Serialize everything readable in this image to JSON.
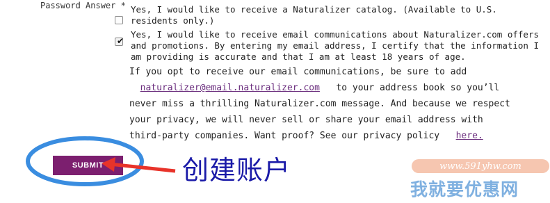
{
  "form": {
    "field_label": "Password Answer *",
    "optin_catalog": {
      "text": "Yes, I would like to receive a  Naturalizer  catalog. (Available to U.S. residents only.)",
      "checked": false
    },
    "optin_email": {
      "text": "Yes, I would like to receive email communications about   Naturalizer.com  offers and promotions. By entering my email address, I certify that the information I am providing is accurate and that I am at least 18 years of age.",
      "checked": true
    },
    "info": {
      "part1": "If you opt to receive our email communications, be sure to add",
      "email_link": "naturalizer@email.naturalizer.com",
      "part2": "to your address book so you’ll never miss a thrilling   Naturalizer.com   message. And because we respect your privacy, we will never sell or share your email address with third-party companies. Want proof? See our privacy policy",
      "here_link": "here."
    },
    "submit_label": "SUBMIT"
  },
  "annotation": {
    "caption": "创建账户",
    "ellipse_color": "#3a8de0",
    "arrow_color": "#e8332a"
  },
  "watermark": {
    "url": "www.591yhw.com",
    "text": "我就要优惠网"
  }
}
